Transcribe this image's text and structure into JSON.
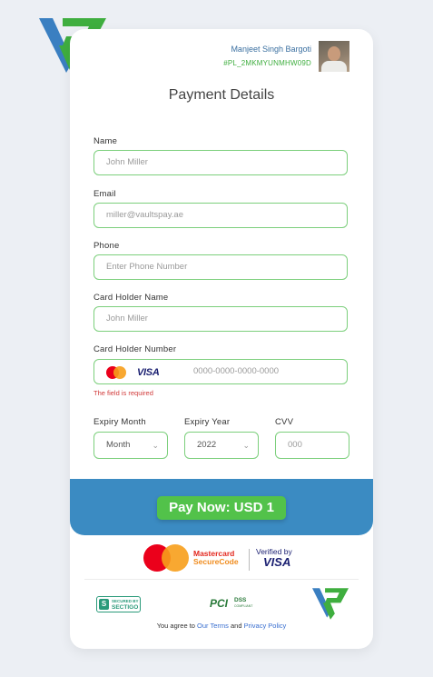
{
  "merchant": {
    "name": "Manjeet Singh Bargoti",
    "id": "#PL_2MKMYUNMHW09D"
  },
  "title": "Payment Details",
  "fields": {
    "name": {
      "label": "Name",
      "placeholder": "John Miller"
    },
    "email": {
      "label": "Email",
      "placeholder": "miller@vaultspay.ae"
    },
    "phone": {
      "label": "Phone",
      "placeholder": "Enter Phone Number"
    },
    "card_holder_name": {
      "label": "Card Holder Name",
      "placeholder": "John Miller"
    },
    "card_holder_number": {
      "label": "Card Holder Number",
      "placeholder": "0000-0000-0000-0000",
      "visa_text": "VISA",
      "error": "The field is required"
    },
    "expiry_month": {
      "label": "Expiry Month",
      "value": "Month"
    },
    "expiry_year": {
      "label": "Expiry Year",
      "value": "2022"
    },
    "cvv": {
      "label": "CVV",
      "placeholder": "000"
    }
  },
  "pay_button": "Pay Now: USD 1",
  "badges": {
    "mastercard_line1": "Mastercard",
    "mastercard_line2": "SecureCode",
    "verified_by": "Verified by",
    "visa": "VISA",
    "sectigo_badge": "S",
    "sectigo_line1": "SECURED BY",
    "sectigo_line2": "SECTIGO",
    "pci": "PCI",
    "pci_dss": "DSS",
    "pci_compliant": "COMPLIANT"
  },
  "footer": {
    "prefix": "You agree to ",
    "link1": "Our Terms",
    "and": " and ",
    "link2": "Privacy Policy"
  },
  "colors": {
    "primary_blue": "#3b8bc2",
    "accent_green": "#52c24a",
    "border_green": "#7ccf7c",
    "error_red": "#d13b3b",
    "logo_blue": "#3a7fc1",
    "logo_green": "#3fae3f"
  },
  "icons": [
    "vaultspay-logo-icon",
    "mastercard-icon",
    "visa-icon",
    "chevron-down-icon",
    "sectigo-badge-icon",
    "pci-dss-icon"
  ]
}
